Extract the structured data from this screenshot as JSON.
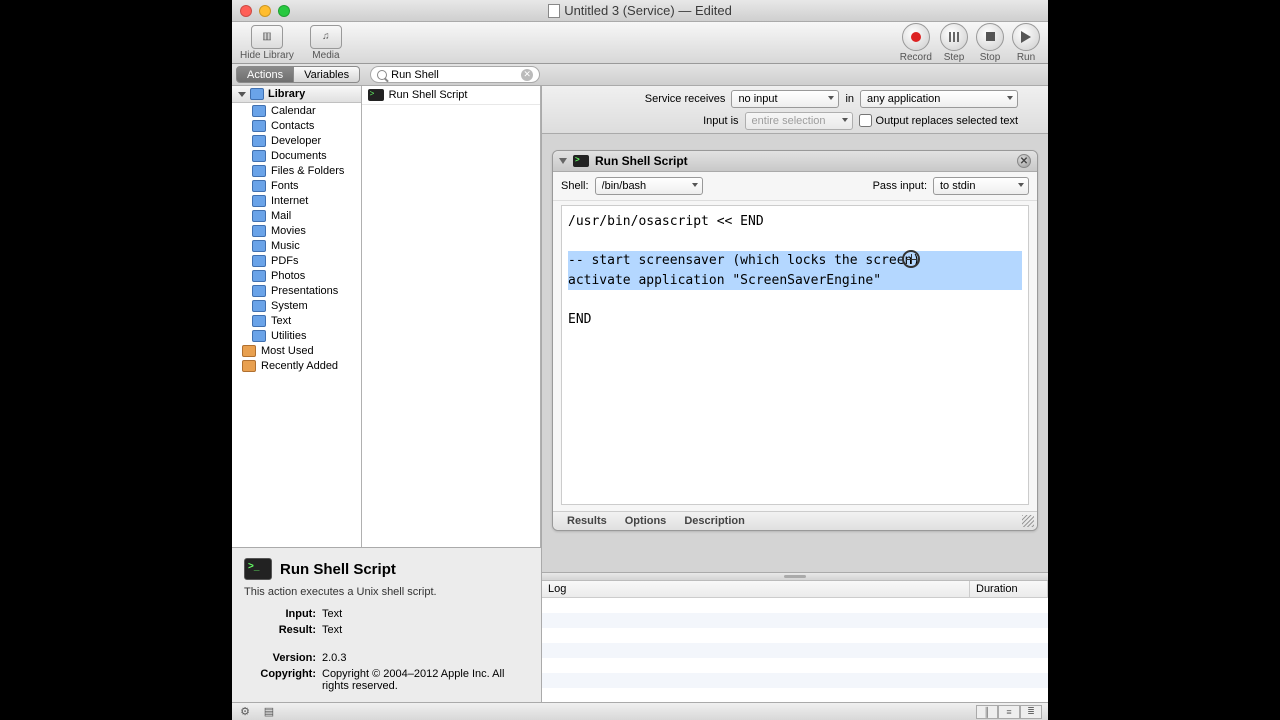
{
  "title": "Untitled 3 (Service) — Edited",
  "traffic": {
    "close": "close",
    "min": "minimize",
    "max": "zoom"
  },
  "toolbar": {
    "hide_library": "Hide Library",
    "media": "Media",
    "record": "Record",
    "step": "Step",
    "stop": "Stop",
    "run": "Run"
  },
  "tabs": {
    "actions": "Actions",
    "variables": "Variables"
  },
  "search": {
    "value": "Run Shell"
  },
  "library": {
    "header": "Library",
    "items": [
      "Calendar",
      "Contacts",
      "Developer",
      "Documents",
      "Files & Folders",
      "Fonts",
      "Internet",
      "Mail",
      "Movies",
      "Music",
      "PDFs",
      "Photos",
      "Presentations",
      "System",
      "Text",
      "Utilities"
    ],
    "smart": [
      "Most Used",
      "Recently Added"
    ]
  },
  "results": {
    "run_shell_script": "Run Shell Script"
  },
  "config": {
    "service_receives": "Service receives",
    "no_input": "no input",
    "in": "in",
    "any_application": "any application",
    "input_is": "Input is",
    "entire_selection": "entire selection",
    "output_replaces": "Output replaces selected text"
  },
  "action": {
    "title": "Run Shell Script",
    "shell_label": "Shell:",
    "shell_value": "/bin/bash",
    "pass_input_label": "Pass input:",
    "pass_input_value": "to stdin",
    "script_line1": "/usr/bin/osascript << END",
    "script_line2": "",
    "script_line3": "-- start screensaver (which locks the screen)",
    "script_line4": "activate application \"ScreenSaverEngine\"",
    "script_line5": "",
    "script_line6": "END",
    "footer_results": "Results",
    "footer_options": "Options",
    "footer_description": "Description"
  },
  "info": {
    "title": "Run Shell Script",
    "desc": "This action executes a Unix shell script.",
    "input_k": "Input:",
    "input_v": "Text",
    "result_k": "Result:",
    "result_v": "Text",
    "version_k": "Version:",
    "version_v": "2.0.3",
    "copyright_k": "Copyright:",
    "copyright_v": "Copyright © 2004–2012 Apple Inc.  All rights reserved."
  },
  "log": {
    "log_col": "Log",
    "duration_col": "Duration"
  }
}
